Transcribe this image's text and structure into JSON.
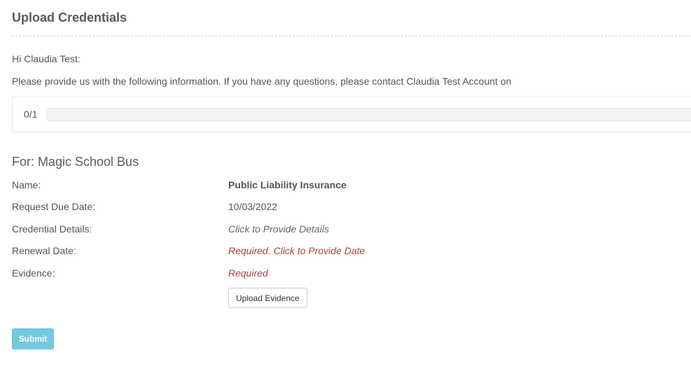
{
  "header": {
    "title": "Upload Credentials"
  },
  "intro": {
    "greeting": "Hi Claudia Test:",
    "instructions": "Please provide us with the following information. If you have any questions, please contact Claudia Test Account on"
  },
  "progress": {
    "label": "0/1",
    "completed": 0,
    "total": 1
  },
  "request": {
    "heading": "For: Magic School Bus",
    "rows": [
      {
        "label": "Name:",
        "value": "Public Liability Insurance"
      },
      {
        "label": "Request Due Date:",
        "value": "10/03/2022"
      },
      {
        "label": "Credential Details:",
        "value": "Click to Provide Details"
      },
      {
        "label": "Renewal Date:",
        "value": "Required. Click to Provide Date"
      },
      {
        "label": "Evidence:",
        "value": "Required"
      }
    ],
    "upload_label": "Upload Evidence"
  },
  "actions": {
    "submit_label": "Submit"
  },
  "colors": {
    "accent": "#5bc0de",
    "required": "#a94442"
  }
}
